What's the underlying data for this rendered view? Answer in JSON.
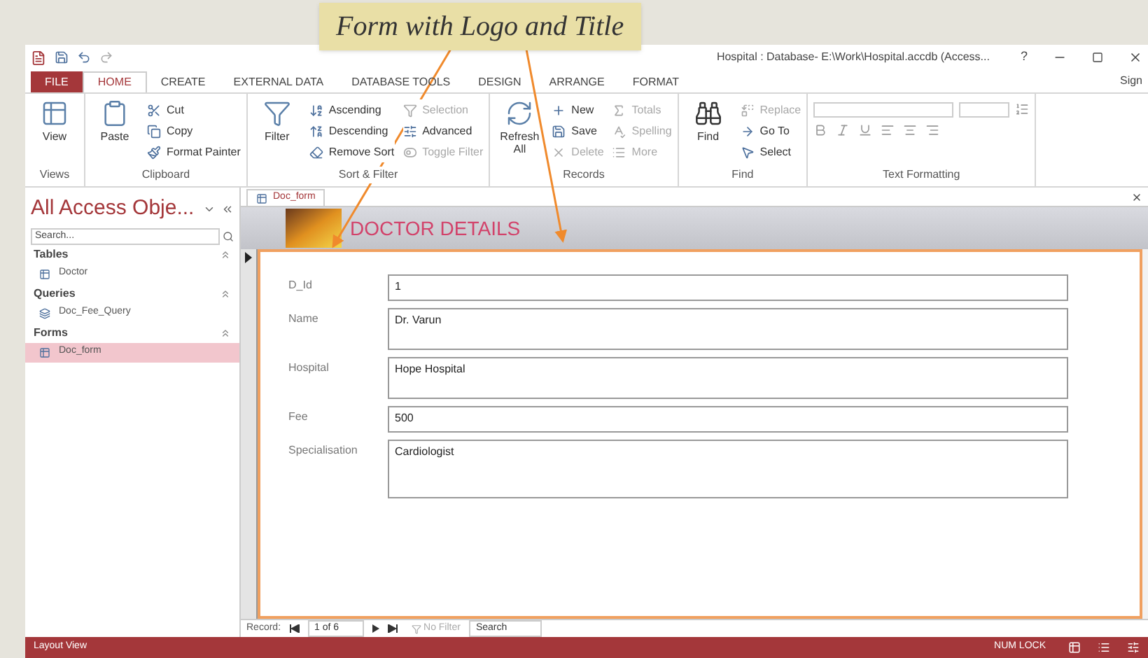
{
  "callout": {
    "text": "Form with Logo and Title"
  },
  "title_bar": {
    "title": "Hospital : Database- E:\\Work\\Hospital.accdb (Access...",
    "help": "?",
    "account": "Sign"
  },
  "ribbon_tabs": [
    {
      "label": "FILE",
      "kind": "file",
      "selected": false
    },
    {
      "label": "HOME",
      "kind": "normal",
      "selected": true
    },
    {
      "label": "CREATE",
      "kind": "normal",
      "selected": false
    },
    {
      "label": "EXTERNAL DATA",
      "kind": "normal",
      "selected": false
    },
    {
      "label": "DATABASE TOOLS",
      "kind": "normal",
      "selected": false
    },
    {
      "label": "DESIGN",
      "kind": "normal",
      "selected": false
    },
    {
      "label": "ARRANGE",
      "kind": "normal",
      "selected": false
    },
    {
      "label": "FORMAT",
      "kind": "normal",
      "selected": false
    }
  ],
  "ribbon_groups": [
    {
      "label": "Views",
      "commands": [
        {
          "label": "View",
          "kind": "large",
          "disabled": false
        }
      ]
    },
    {
      "label": "Clipboard",
      "commands": [
        {
          "label": "Paste",
          "kind": "large",
          "disabled": false
        },
        {
          "label": "Cut",
          "kind": "small",
          "disabled": false
        },
        {
          "label": "Copy",
          "kind": "small",
          "disabled": false
        },
        {
          "label": "Format Painter",
          "kind": "small",
          "disabled": false
        }
      ]
    },
    {
      "label": "Sort & Filter",
      "commands": [
        {
          "label": "Filter",
          "kind": "large",
          "disabled": false
        },
        {
          "label": "Ascending",
          "kind": "small",
          "disabled": false
        },
        {
          "label": "Descending",
          "kind": "small",
          "disabled": false
        },
        {
          "label": "Remove Sort",
          "kind": "small",
          "disabled": false
        },
        {
          "label": "Selection",
          "kind": "small",
          "disabled": true
        },
        {
          "label": "Advanced",
          "kind": "small",
          "disabled": false
        },
        {
          "label": "Toggle Filter",
          "kind": "small",
          "disabled": true
        }
      ]
    },
    {
      "label": "Records",
      "commands": [
        {
          "label": "Refresh All",
          "kind": "large",
          "disabled": false
        },
        {
          "label": "New",
          "kind": "small",
          "disabled": false
        },
        {
          "label": "Save",
          "kind": "small",
          "disabled": false
        },
        {
          "label": "Delete",
          "kind": "small",
          "disabled": true
        },
        {
          "label": "Totals",
          "kind": "small",
          "disabled": true
        },
        {
          "label": "Spelling",
          "kind": "small",
          "disabled": true
        },
        {
          "label": "More",
          "kind": "small",
          "disabled": true
        }
      ]
    },
    {
      "label": "Find",
      "commands": [
        {
          "label": "Find",
          "kind": "large",
          "disabled": false
        },
        {
          "label": "Replace",
          "kind": "small",
          "disabled": true
        },
        {
          "label": "Go To",
          "kind": "small",
          "disabled": false
        },
        {
          "label": "Select",
          "kind": "small",
          "disabled": false
        }
      ]
    },
    {
      "label": "Text Formatting"
    }
  ],
  "nav_pane": {
    "title": "All Access Obje...",
    "search": {
      "placeholder": "Search..."
    },
    "groups": [
      {
        "label": "Tables",
        "items": [
          {
            "label": "Doctor",
            "selected": false
          }
        ]
      },
      {
        "label": "Queries",
        "items": [
          {
            "label": "Doc_Fee_Query",
            "selected": false
          }
        ]
      },
      {
        "label": "Forms",
        "items": [
          {
            "label": "Doc_form",
            "selected": true
          }
        ]
      }
    ]
  },
  "document_tab": {
    "label": "Doc_form"
  },
  "form": {
    "title": "DOCTOR DETAILS",
    "fields": [
      {
        "label": "D_Id",
        "value": "1",
        "kind": "short"
      },
      {
        "label": "Name",
        "value": "Dr. Varun",
        "kind": "medium"
      },
      {
        "label": "Hospital",
        "value": "Hope Hospital",
        "kind": "medium"
      },
      {
        "label": "Fee",
        "value": "500",
        "kind": "short"
      },
      {
        "label": "Specialisation",
        "value": "Cardiologist",
        "kind": "tall"
      }
    ]
  },
  "record_nav": {
    "label": "Record:",
    "position": "1 of 6",
    "filter": "No Filter",
    "search": "Search"
  },
  "status_bar": {
    "view": "Layout View",
    "num_lock": "NUM LOCK"
  }
}
